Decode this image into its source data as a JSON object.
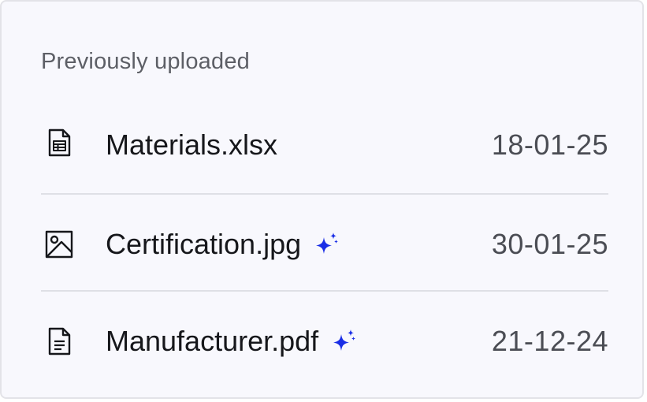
{
  "section": {
    "title": "Previously uploaded"
  },
  "files": [
    {
      "name": "Materials.xlsx",
      "date": "18-01-25",
      "icon": "spreadsheet-file-icon",
      "ai": false
    },
    {
      "name": "Certification.jpg",
      "date": "30-01-25",
      "icon": "image-file-icon",
      "ai": true
    },
    {
      "name": "Manufacturer.pdf",
      "date": "21-12-24",
      "icon": "document-file-icon",
      "ai": true
    }
  ],
  "colors": {
    "card_background": "#f8f8fd",
    "card_border": "#e3e3e8",
    "divider": "#dfe0e6",
    "title_text": "#5d5f66",
    "file_name_text": "#16171b",
    "date_text": "#4b4d54",
    "ai_sparkle": "#1a2ee6"
  }
}
